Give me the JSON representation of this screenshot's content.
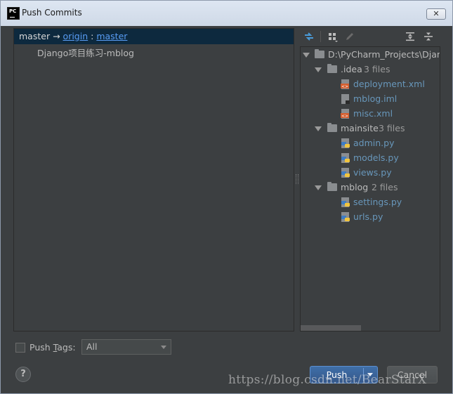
{
  "window": {
    "title": "Push Commits",
    "app_icon_text": "PC",
    "close_label": "✕"
  },
  "commits": {
    "local_branch": "master",
    "arrow": "→",
    "remote": "origin",
    "separator": ":",
    "remote_branch": "master",
    "items": [
      "Django项目练习-mblog"
    ]
  },
  "toolbar": {
    "icons": [
      "compare-icon",
      "group-icon",
      "edit-icon",
      "expand-all-icon",
      "collapse-all-icon"
    ]
  },
  "tree": {
    "root": "D:\\PyCharm_Projects\\Django",
    "folders": [
      {
        "name": ".idea",
        "count": "3 files",
        "files": [
          {
            "name": "deployment.xml",
            "type": "xml"
          },
          {
            "name": "mblog.iml",
            "type": "iml"
          },
          {
            "name": "misc.xml",
            "type": "xml"
          }
        ]
      },
      {
        "name": "mainsite",
        "count": "3 files",
        "files": [
          {
            "name": "admin.py",
            "type": "py"
          },
          {
            "name": "models.py",
            "type": "py"
          },
          {
            "name": "views.py",
            "type": "py"
          }
        ]
      },
      {
        "name": "mblog",
        "count": "2 files",
        "files": [
          {
            "name": "settings.py",
            "type": "py"
          },
          {
            "name": "urls.py",
            "type": "py"
          }
        ]
      }
    ]
  },
  "footer": {
    "push_tags_label_pre": "Push ",
    "push_tags_label_mnemonic": "T",
    "push_tags_label_post": "ags:",
    "push_tags_checked": false,
    "tags_value": "All",
    "help_label": "?",
    "push_label_mnemonic": "P",
    "push_label_rest": "ush",
    "cancel_label": "Cancel"
  },
  "watermark": "https://blog.csdn.net/BearStarX",
  "colors": {
    "panel_bg": "#3c3f41",
    "selection": "#0d293e",
    "link": "#589df6",
    "file_link": "#6897bb",
    "primary_button": "#3f6fa8"
  }
}
